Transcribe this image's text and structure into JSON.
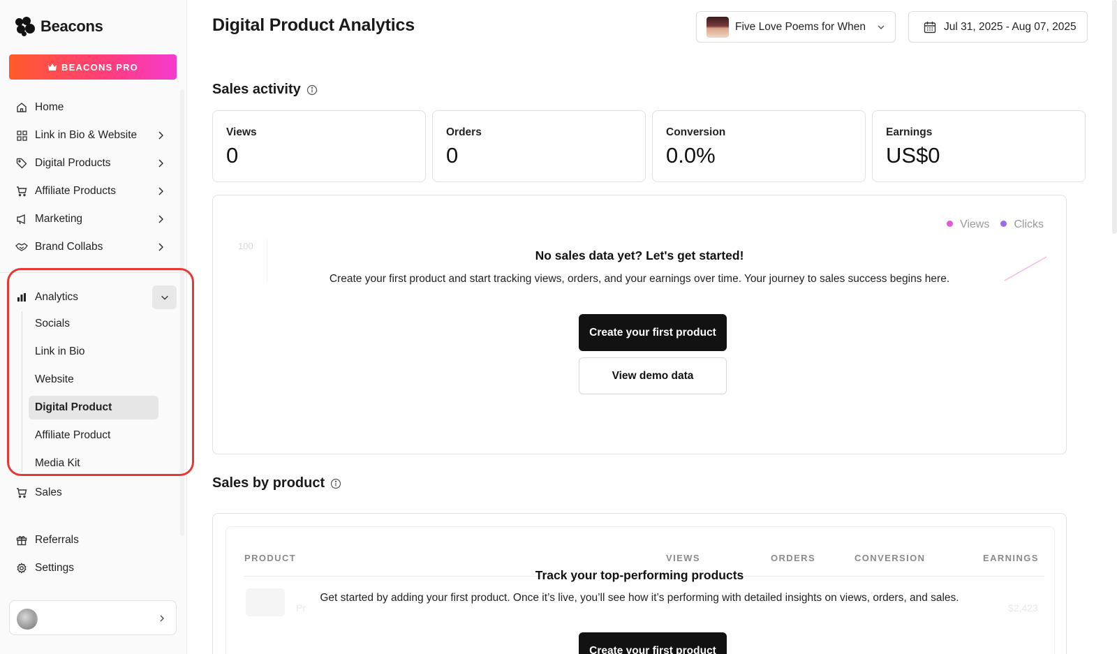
{
  "brand": {
    "name": "Beacons",
    "pro_label": "BEACONS PRO"
  },
  "sidebar": {
    "items": [
      {
        "label": "Home",
        "icon": "home-icon"
      },
      {
        "label": "Link in Bio & Website",
        "icon": "grid-icon"
      },
      {
        "label": "Digital Products",
        "icon": "tag-icon"
      },
      {
        "label": "Affiliate Products",
        "icon": "cart-icon"
      },
      {
        "label": "Marketing",
        "icon": "megaphone-icon"
      },
      {
        "label": "Brand Collabs",
        "icon": "handshake-icon"
      }
    ],
    "analytics": {
      "label": "Analytics",
      "icon": "bar-chart-icon",
      "expanded": true,
      "sub_items": [
        {
          "label": "Socials"
        },
        {
          "label": "Link in Bio"
        },
        {
          "label": "Website"
        },
        {
          "label": "Digital Product",
          "active": true
        },
        {
          "label": "Affiliate Product"
        },
        {
          "label": "Media Kit"
        }
      ]
    },
    "bottom_items": [
      {
        "label": "Sales",
        "icon": "cart-icon"
      },
      {
        "label": "Referrals",
        "icon": "gift-icon"
      },
      {
        "label": "Settings",
        "icon": "gear-icon"
      }
    ]
  },
  "header": {
    "title": "Digital Product Analytics",
    "product_select": {
      "value": "Five Love Poems for When"
    },
    "date_range": {
      "value": "Jul 31, 2025 - Aug 07, 2025"
    }
  },
  "sales_activity": {
    "title": "Sales activity",
    "stats": [
      {
        "label": "Views",
        "value": "0"
      },
      {
        "label": "Orders",
        "value": "0"
      },
      {
        "label": "Conversion",
        "value": "0.0%"
      },
      {
        "label": "Earnings",
        "value": "US$0"
      }
    ],
    "legend": [
      {
        "name": "Views",
        "color": "#e05ad8"
      },
      {
        "name": "Clicks",
        "color": "#9a6af0"
      }
    ],
    "y_tick": "100",
    "empty": {
      "title": "No sales data yet? Let's get started!",
      "description": "Create your first product and start tracking views, orders, and your earnings over time. Your journey to sales success begins here.",
      "primary_button": "Create your first product",
      "secondary_button": "View demo data"
    }
  },
  "sales_by_product": {
    "title": "Sales by product",
    "columns": [
      "PRODUCT",
      "VIEWS",
      "ORDERS",
      "CONVERSION",
      "EARNINGS"
    ],
    "ghost_product": "Pr",
    "ghost_earnings": "$2,423",
    "empty": {
      "title": "Track your top-performing products",
      "description": "Get started by adding your first product. Once it’s live, you’ll see how it’s performing with detailed insights on views, orders, and sales.",
      "primary_button": "Create your first product"
    }
  },
  "colors": {
    "accent_gradient_start": "#ff5a2b",
    "accent_gradient_end": "#f43bd0",
    "highlight": "#e53935",
    "dark_button": "#121212"
  }
}
